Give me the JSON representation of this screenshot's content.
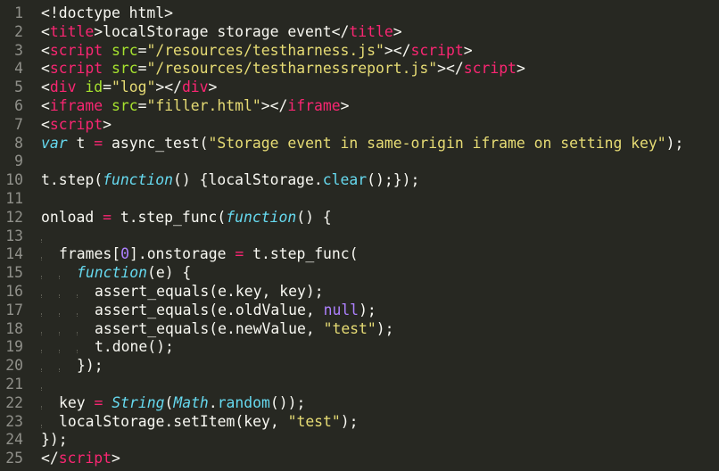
{
  "editor": {
    "lines": [
      {
        "n": "1",
        "tokens": [
          {
            "t": "<!doctype html>",
            "c": "plain"
          }
        ]
      },
      {
        "n": "2",
        "tokens": [
          {
            "t": "<",
            "c": "plain"
          },
          {
            "t": "title",
            "c": "tag"
          },
          {
            "t": ">localStorage storage event</",
            "c": "plain"
          },
          {
            "t": "title",
            "c": "tag"
          },
          {
            "t": ">",
            "c": "plain"
          }
        ]
      },
      {
        "n": "3",
        "tokens": [
          {
            "t": "<",
            "c": "plain"
          },
          {
            "t": "script",
            "c": "tag"
          },
          {
            "t": " ",
            "c": "plain"
          },
          {
            "t": "src",
            "c": "attr"
          },
          {
            "t": "=",
            "c": "plain"
          },
          {
            "t": "\"/resources/testharness.js\"",
            "c": "str"
          },
          {
            "t": "></",
            "c": "plain"
          },
          {
            "t": "script",
            "c": "tag"
          },
          {
            "t": ">",
            "c": "plain"
          }
        ]
      },
      {
        "n": "4",
        "tokens": [
          {
            "t": "<",
            "c": "plain"
          },
          {
            "t": "script",
            "c": "tag"
          },
          {
            "t": " ",
            "c": "plain"
          },
          {
            "t": "src",
            "c": "attr"
          },
          {
            "t": "=",
            "c": "plain"
          },
          {
            "t": "\"/resources/testharnessreport.js\"",
            "c": "str"
          },
          {
            "t": "></",
            "c": "plain"
          },
          {
            "t": "script",
            "c": "tag"
          },
          {
            "t": ">",
            "c": "plain"
          }
        ]
      },
      {
        "n": "5",
        "tokens": [
          {
            "t": "<",
            "c": "plain"
          },
          {
            "t": "div",
            "c": "tag"
          },
          {
            "t": " ",
            "c": "plain"
          },
          {
            "t": "id",
            "c": "attr"
          },
          {
            "t": "=",
            "c": "plain"
          },
          {
            "t": "\"log\"",
            "c": "str"
          },
          {
            "t": "></",
            "c": "plain"
          },
          {
            "t": "div",
            "c": "tag"
          },
          {
            "t": ">",
            "c": "plain"
          }
        ]
      },
      {
        "n": "6",
        "tokens": [
          {
            "t": "<",
            "c": "plain"
          },
          {
            "t": "iframe",
            "c": "tag"
          },
          {
            "t": " ",
            "c": "plain"
          },
          {
            "t": "src",
            "c": "attr"
          },
          {
            "t": "=",
            "c": "plain"
          },
          {
            "t": "\"filler.html\"",
            "c": "str"
          },
          {
            "t": "></",
            "c": "plain"
          },
          {
            "t": "iframe",
            "c": "tag"
          },
          {
            "t": ">",
            "c": "plain"
          }
        ]
      },
      {
        "n": "7",
        "tokens": [
          {
            "t": "<",
            "c": "plain"
          },
          {
            "t": "script",
            "c": "tag"
          },
          {
            "t": ">",
            "c": "plain"
          }
        ]
      },
      {
        "n": "8",
        "tokens": [
          {
            "t": "var",
            "c": "storage"
          },
          {
            "t": " t ",
            "c": "plain"
          },
          {
            "t": "=",
            "c": "kw"
          },
          {
            "t": " async_test(",
            "c": "plain"
          },
          {
            "t": "\"Storage event in same-origin iframe on setting key\"",
            "c": "str"
          },
          {
            "t": ");",
            "c": "plain"
          }
        ]
      },
      {
        "n": "9",
        "tokens": []
      },
      {
        "n": "10",
        "tokens": [
          {
            "t": "t.step(",
            "c": "plain"
          },
          {
            "t": "function",
            "c": "storage"
          },
          {
            "t": "() {localStorage.",
            "c": "plain"
          },
          {
            "t": "clear",
            "c": "support"
          },
          {
            "t": "();});",
            "c": "plain"
          }
        ]
      },
      {
        "n": "11",
        "tokens": []
      },
      {
        "n": "12",
        "tokens": [
          {
            "t": "onload ",
            "c": "plain"
          },
          {
            "t": "=",
            "c": "kw"
          },
          {
            "t": " t.step_func(",
            "c": "plain"
          },
          {
            "t": "function",
            "c": "storage"
          },
          {
            "t": "() {",
            "c": "plain"
          }
        ]
      },
      {
        "n": "13",
        "tokens": [],
        "guides": 1
      },
      {
        "n": "14",
        "tokens": [
          {
            "t": "frames[",
            "c": "plain"
          },
          {
            "t": "0",
            "c": "const"
          },
          {
            "t": "].onstorage ",
            "c": "plain"
          },
          {
            "t": "=",
            "c": "kw"
          },
          {
            "t": " t.step_func(",
            "c": "plain"
          }
        ],
        "guides": 1
      },
      {
        "n": "15",
        "tokens": [
          {
            "t": "function",
            "c": "storage"
          },
          {
            "t": "(e) {",
            "c": "plain"
          }
        ],
        "guides": 2
      },
      {
        "n": "16",
        "tokens": [
          {
            "t": "assert_equals(e.key, key);",
            "c": "plain"
          }
        ],
        "guides": 3
      },
      {
        "n": "17",
        "tokens": [
          {
            "t": "assert_equals(e.oldValue, ",
            "c": "plain"
          },
          {
            "t": "null",
            "c": "const"
          },
          {
            "t": ");",
            "c": "plain"
          }
        ],
        "guides": 3
      },
      {
        "n": "18",
        "tokens": [
          {
            "t": "assert_equals(e.newValue, ",
            "c": "plain"
          },
          {
            "t": "\"test\"",
            "c": "str"
          },
          {
            "t": ");",
            "c": "plain"
          }
        ],
        "guides": 3
      },
      {
        "n": "19",
        "tokens": [
          {
            "t": "t.done();",
            "c": "plain"
          }
        ],
        "guides": 3
      },
      {
        "n": "20",
        "tokens": [
          {
            "t": "});",
            "c": "plain"
          }
        ],
        "guides": 2
      },
      {
        "n": "21",
        "tokens": [],
        "guides": 1
      },
      {
        "n": "22",
        "tokens": [
          {
            "t": "key ",
            "c": "plain"
          },
          {
            "t": "=",
            "c": "kw"
          },
          {
            "t": " ",
            "c": "plain"
          },
          {
            "t": "String",
            "c": "storage"
          },
          {
            "t": "(",
            "c": "plain"
          },
          {
            "t": "Math",
            "c": "storage"
          },
          {
            "t": ".",
            "c": "plain"
          },
          {
            "t": "random",
            "c": "support"
          },
          {
            "t": "());",
            "c": "plain"
          }
        ],
        "guides": 1
      },
      {
        "n": "23",
        "tokens": [
          {
            "t": "localStorage.setItem(key, ",
            "c": "plain"
          },
          {
            "t": "\"test\"",
            "c": "str"
          },
          {
            "t": ");",
            "c": "plain"
          }
        ],
        "guides": 1
      },
      {
        "n": "24",
        "tokens": [
          {
            "t": "});",
            "c": "plain"
          }
        ]
      },
      {
        "n": "25",
        "tokens": [
          {
            "t": "</",
            "c": "plain"
          },
          {
            "t": "script",
            "c": "tag"
          },
          {
            "t": ">",
            "c": "plain"
          }
        ]
      }
    ]
  },
  "colors": {
    "background": "#272822",
    "foreground": "#F8F8F2",
    "line_number": "#90908A",
    "tag_keyword": "#F92672",
    "attribute": "#A6E22E",
    "string": "#E6DB74",
    "storage_type": "#66D9EF",
    "constant": "#AE81FF"
  }
}
